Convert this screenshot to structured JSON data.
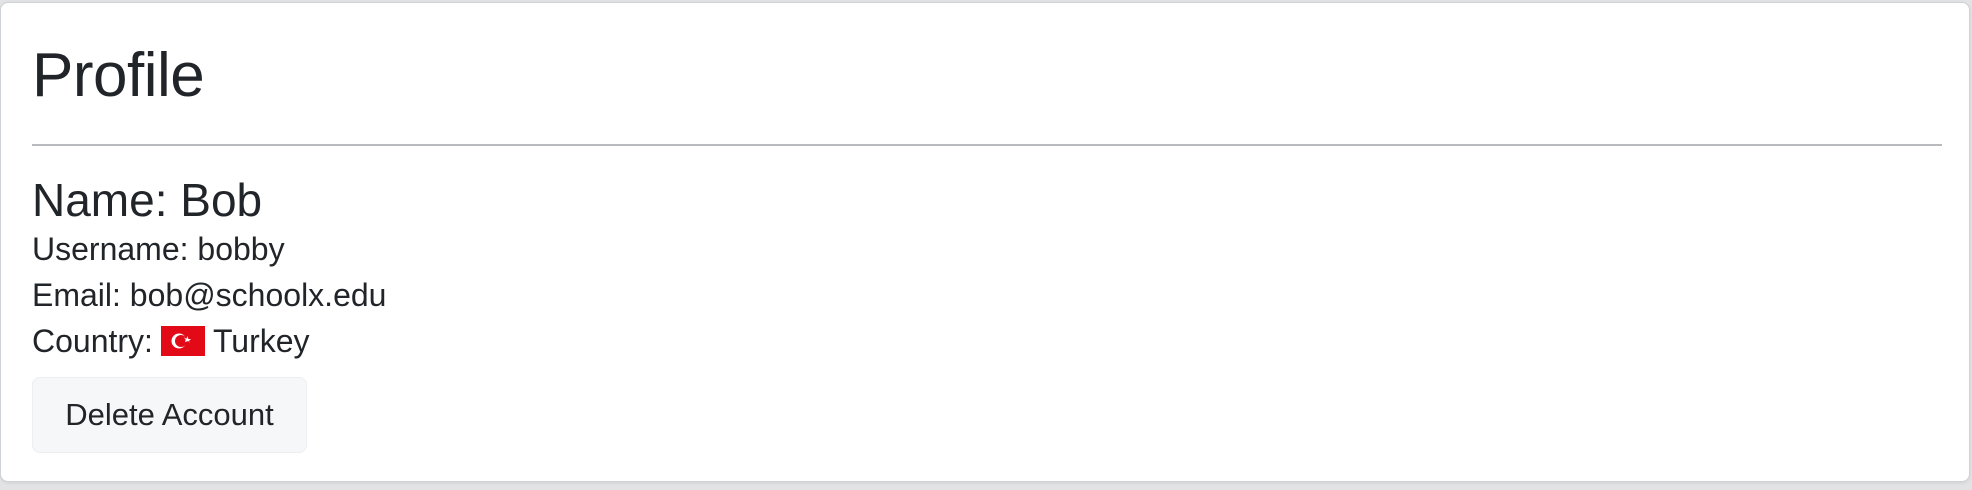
{
  "profile": {
    "title": "Profile",
    "name_label": "Name:",
    "name_value": "Bob",
    "username_label": "Username:",
    "username_value": "bobby",
    "email_label": "Email:",
    "email_value": "bob@schoolx.edu",
    "country_label": "Country:",
    "country_value": "Turkey",
    "country_flag_icon": "turkey-flag-icon",
    "flag_color": "#e30a17"
  },
  "actions": {
    "delete_label": "Delete Account"
  }
}
